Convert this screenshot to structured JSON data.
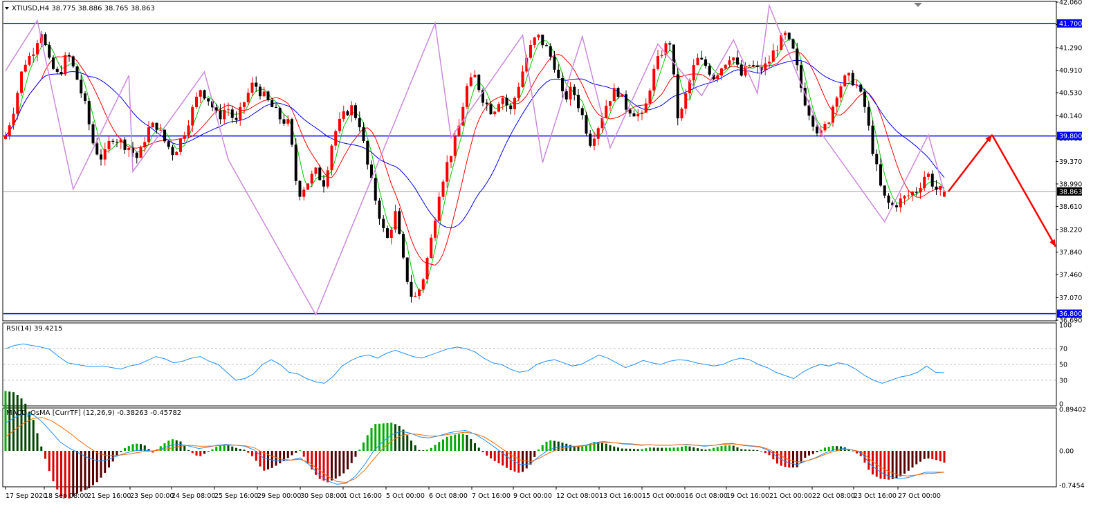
{
  "header": {
    "symbol_label": "XTIUSD,H4  38.775 38.886 38.765 38.863"
  },
  "rsi": {
    "label": "RSI(14) 39.4215",
    "levels": [
      70,
      50,
      30
    ],
    "ticks": [
      "100",
      "70",
      "50",
      "30",
      "0"
    ]
  },
  "macd": {
    "label": "MACD_OsMA [CurrTF] (12,26,9) -0.38263 -0.45782",
    "ticks": [
      "0.89402",
      "0.00",
      "-0.7454"
    ]
  },
  "colors": {
    "bull": "#ff0000",
    "bear": "#000000",
    "hline": "#0000ff",
    "zigzag": "#cc88dd",
    "ma_fast": "#00cc00",
    "ma_mid": "#ff0000",
    "ma_slow": "#0000ff",
    "rsi_line": "#1e90ff",
    "macd_line": "#1e90ff",
    "signal_line": "#ff6a00",
    "osma_up": "#00aa00",
    "osma_down": "#cc0000",
    "price_box": "#0000ff",
    "current_box": "#000000"
  },
  "chart_data": {
    "type": "candlestick",
    "title": "XTIUSD,H4",
    "ohlc_readout": [
      38.775,
      38.886,
      38.765,
      38.863
    ],
    "y_ticks": [
      "42.060",
      "41.680",
      "41.290",
      "40.910",
      "40.530",
      "40.140",
      "39.760",
      "39.370",
      "38.990",
      "38.610",
      "38.220",
      "37.840",
      "37.460",
      "37.070",
      "36.690"
    ],
    "ylim": [
      36.69,
      42.06
    ],
    "x_labels": [
      "17 Sep 2020",
      "18 Sep 08:00",
      "21 Sep 16:00",
      "23 Sep 00:00",
      "24 Sep 08:00",
      "25 Sep 16:00",
      "29 Sep 00:00",
      "30 Sep 08:00",
      "1 Oct 16:00",
      "5 Oct 00:00",
      "6 Oct 08:00",
      "7 Oct 16:00",
      "9 Oct 00:00",
      "12 Oct 08:00",
      "13 Oct 16:00",
      "15 Oct 00:00",
      "16 Oct 08:00",
      "19 Oct 16:00",
      "21 Oct 00:00",
      "22 Oct 08:00",
      "23 Oct 16:00",
      "27 Oct 00:00"
    ],
    "horizontal_lines": [
      {
        "value": 41.7,
        "label": "41.700"
      },
      {
        "value": 39.8,
        "label": "39.800"
      },
      {
        "value": 36.8,
        "label": "36.800"
      }
    ],
    "current_price": {
      "value": 38.863,
      "label": "38.863"
    },
    "close_path": [
      39.8,
      40.3,
      41.0,
      41.2,
      41.6,
      41.0,
      40.8,
      41.2,
      40.8,
      40.3,
      39.6,
      39.4,
      39.8,
      39.7,
      39.6,
      39.4,
      39.9,
      40.0,
      39.7,
      39.5,
      39.8,
      40.2,
      40.6,
      40.4,
      40.1,
      40.3,
      40.0,
      40.4,
      40.7,
      40.5,
      40.3,
      40.1,
      40.0,
      38.8,
      39.0,
      39.2,
      39.0,
      39.8,
      40.1,
      40.3,
      40.0,
      39.2,
      38.6,
      38.0,
      38.5,
      37.6,
      37.0,
      37.3,
      38.0,
      38.9,
      39.4,
      39.8,
      40.6,
      40.8,
      40.4,
      40.2,
      40.5,
      40.2,
      40.7,
      41.2,
      41.5,
      41.3,
      41.0,
      40.4,
      40.6,
      40.2,
      39.7,
      40.0,
      40.4,
      40.6,
      40.3,
      40.2,
      40.1,
      40.8,
      41.2,
      41.4,
      40.0,
      40.6,
      41.1,
      41.0,
      40.8,
      41.0,
      41.2,
      40.8,
      41.0,
      40.9,
      41.0,
      41.3,
      41.5,
      41.2,
      40.5,
      40.1,
      39.8,
      40.1,
      40.6,
      40.8,
      40.7,
      40.3,
      39.5,
      38.8,
      38.6,
      38.7,
      38.8,
      38.9,
      39.2,
      38.9,
      38.86
    ],
    "zigzag": [
      [
        0,
        40.9
      ],
      [
        8,
        41.75
      ],
      [
        17,
        38.9
      ],
      [
        31,
        40.82
      ],
      [
        32,
        39.2
      ],
      [
        50,
        40.88
      ],
      [
        56,
        39.4
      ],
      [
        78,
        36.78
      ],
      [
        108,
        41.7
      ],
      [
        112,
        39.77
      ],
      [
        130,
        41.5
      ],
      [
        135,
        39.35
      ],
      [
        145,
        41.48
      ],
      [
        152,
        39.6
      ],
      [
        164,
        41.35
      ],
      [
        175,
        40.48
      ],
      [
        183,
        41.42
      ],
      [
        189,
        40.52
      ],
      [
        192,
        42.0
      ],
      [
        205,
        39.85
      ],
      [
        221,
        38.35
      ],
      [
        232,
        39.82
      ],
      [
        236,
        38.85
      ]
    ],
    "projection": [
      [
        237,
        38.86
      ],
      [
        248,
        39.82
      ],
      [
        264,
        37.93
      ]
    ],
    "rsi_series": [
      70,
      74,
      76,
      74,
      72,
      69,
      60,
      52,
      50,
      48,
      47,
      48,
      46,
      44,
      48,
      50,
      55,
      60,
      57,
      52,
      54,
      58,
      60,
      54,
      50,
      40,
      30,
      32,
      38,
      50,
      56,
      50,
      40,
      38,
      32,
      28,
      26,
      35,
      48,
      55,
      60,
      62,
      58,
      64,
      68,
      64,
      60,
      58,
      62,
      66,
      70,
      72,
      70,
      66,
      58,
      52,
      50,
      44,
      40,
      42,
      50,
      54,
      56,
      52,
      48,
      50,
      56,
      62,
      58,
      52,
      46,
      50,
      55,
      52,
      50,
      54,
      56,
      55,
      52,
      50,
      48,
      50,
      55,
      58,
      56,
      50,
      46,
      40,
      36,
      32,
      40,
      46,
      50,
      48,
      52,
      50,
      44,
      36,
      30,
      26,
      30,
      34,
      36,
      40,
      48,
      40,
      39.4
    ],
    "macd_series": [
      0.6,
      0.72,
      0.8,
      0.78,
      0.62,
      0.4,
      0.18,
      0.05,
      -0.05,
      -0.15,
      -0.22,
      -0.2,
      -0.12,
      -0.05,
      0.0,
      0.02,
      -0.01,
      0.05,
      0.12,
      0.14,
      0.1,
      0.05,
      0.08,
      0.12,
      0.14,
      0.12,
      0.1,
      0.02,
      -0.15,
      -0.2,
      -0.22,
      -0.2,
      -0.15,
      -0.3,
      -0.5,
      -0.65,
      -0.72,
      -0.7,
      -0.55,
      -0.3,
      0.0,
      0.2,
      0.35,
      0.42,
      0.38,
      0.3,
      0.28,
      0.32,
      0.38,
      0.42,
      0.44,
      0.36,
      0.24,
      0.1,
      -0.05,
      -0.2,
      -0.3,
      -0.28,
      -0.12,
      0.02,
      0.08,
      0.1,
      0.1,
      0.12,
      0.18,
      0.2,
      0.18,
      0.15,
      0.14,
      0.12,
      0.13,
      0.12,
      0.12,
      0.13,
      0.14,
      0.12,
      0.1,
      0.12,
      0.15,
      0.16,
      0.12,
      0.1,
      0.08,
      0.0,
      -0.15,
      -0.25,
      -0.3,
      -0.22,
      -0.15,
      -0.05,
      0.02,
      0.05,
      0.02,
      -0.05,
      -0.3,
      -0.45,
      -0.55,
      -0.6,
      -0.58,
      -0.52,
      -0.46,
      -0.46,
      -0.46
    ],
    "signal_series": [
      0.3,
      0.45,
      0.6,
      0.7,
      0.72,
      0.65,
      0.52,
      0.38,
      0.22,
      0.08,
      -0.05,
      -0.1,
      -0.1,
      -0.08,
      -0.05,
      -0.02,
      0.0,
      0.02,
      0.06,
      0.1,
      0.12,
      0.1,
      0.1,
      0.11,
      0.12,
      0.12,
      0.11,
      0.07,
      -0.04,
      -0.12,
      -0.18,
      -0.2,
      -0.18,
      -0.25,
      -0.4,
      -0.55,
      -0.66,
      -0.68,
      -0.6,
      -0.42,
      -0.18,
      0.05,
      0.22,
      0.33,
      0.37,
      0.35,
      0.32,
      0.32,
      0.35,
      0.38,
      0.4,
      0.37,
      0.3,
      0.18,
      0.04,
      -0.1,
      -0.2,
      -0.23,
      -0.16,
      -0.05,
      0.03,
      0.07,
      0.09,
      0.11,
      0.15,
      0.18,
      0.18,
      0.16,
      0.15,
      0.13,
      0.13,
      0.12,
      0.12,
      0.13,
      0.13,
      0.12,
      0.11,
      0.12,
      0.14,
      0.15,
      0.13,
      0.11,
      0.09,
      0.03,
      -0.08,
      -0.18,
      -0.24,
      -0.22,
      -0.16,
      -0.08,
      -0.01,
      0.03,
      0.02,
      -0.02,
      -0.2,
      -0.34,
      -0.45,
      -0.52,
      -0.54,
      -0.52,
      -0.49,
      -0.48,
      -0.46
    ]
  }
}
